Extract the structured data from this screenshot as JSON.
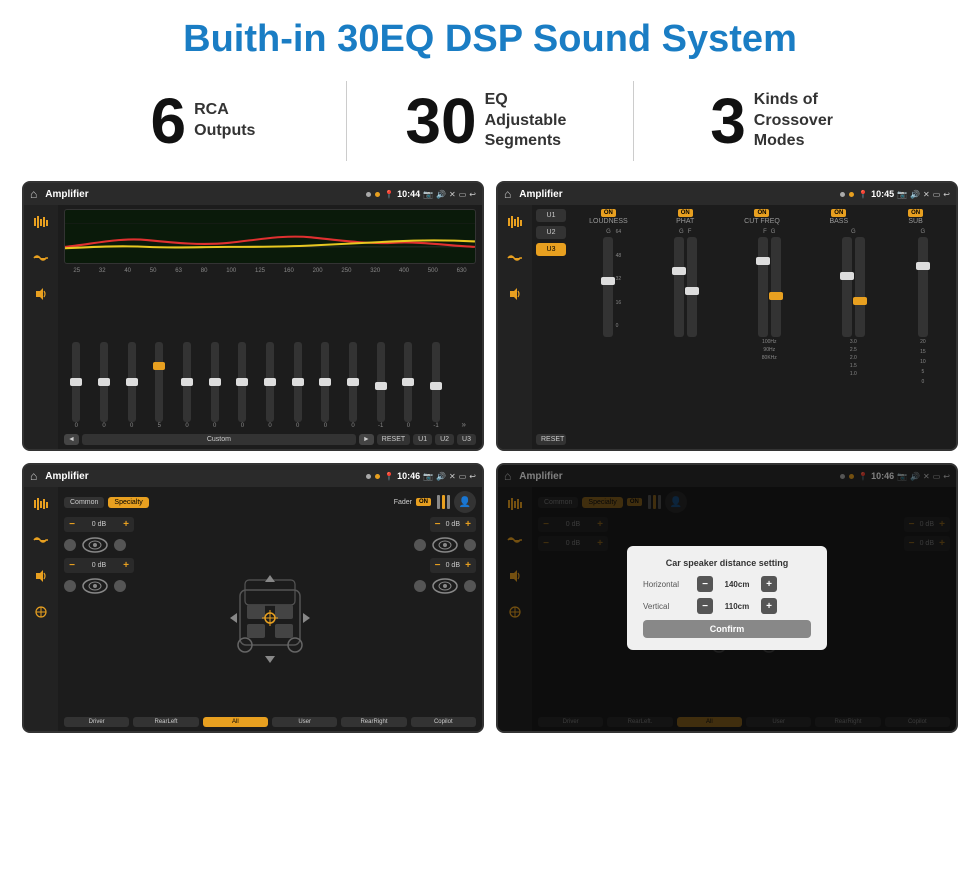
{
  "page": {
    "title": "Buith-in 30EQ DSP Sound System",
    "stats": [
      {
        "number": "6",
        "text": "RCA\nOutputs"
      },
      {
        "number": "30",
        "text": "EQ Adjustable\nSegments"
      },
      {
        "number": "3",
        "text": "Kinds of\nCrossover Modes"
      }
    ]
  },
  "screen1": {
    "title": "Amplifier",
    "time": "10:44",
    "freqs": [
      "25",
      "32",
      "40",
      "50",
      "63",
      "80",
      "100",
      "125",
      "160",
      "200",
      "250",
      "320",
      "400",
      "500",
      "630"
    ],
    "values": [
      "0",
      "0",
      "0",
      "5",
      "0",
      "0",
      "0",
      "0",
      "0",
      "0",
      "0",
      "-1",
      "0",
      "-1"
    ],
    "controls": [
      "◄",
      "Custom",
      "►",
      "RESET",
      "U1",
      "U2",
      "U3"
    ]
  },
  "screen2": {
    "title": "Amplifier",
    "time": "10:45",
    "presets": [
      "U1",
      "U2",
      "U3"
    ],
    "channels": [
      "LOUDNESS",
      "PHAT",
      "CUT FREQ",
      "BASS",
      "SUB"
    ],
    "reset": "RESET"
  },
  "screen3": {
    "title": "Amplifier",
    "time": "10:46",
    "tabs": [
      "Common",
      "Specialty"
    ],
    "faderLabel": "Fader",
    "db_values": [
      "0 dB",
      "0 dB",
      "0 dB",
      "0 dB"
    ],
    "buttons": [
      "Driver",
      "RearLeft",
      "All",
      "User",
      "RearRight",
      "Copilot"
    ]
  },
  "screen4": {
    "title": "Amplifier",
    "time": "10:46",
    "tabs": [
      "Common",
      "Specialty"
    ],
    "dialog": {
      "title": "Car speaker distance setting",
      "horizontal_label": "Horizontal",
      "horizontal_value": "140cm",
      "vertical_label": "Vertical",
      "vertical_value": "110cm",
      "confirm_label": "Confirm"
    },
    "db_right1": "0 dB",
    "db_right2": "0 dB",
    "buttons": [
      "Driver",
      "RearLeft.",
      "All",
      "User",
      "RearRight",
      "Copilot"
    ]
  }
}
